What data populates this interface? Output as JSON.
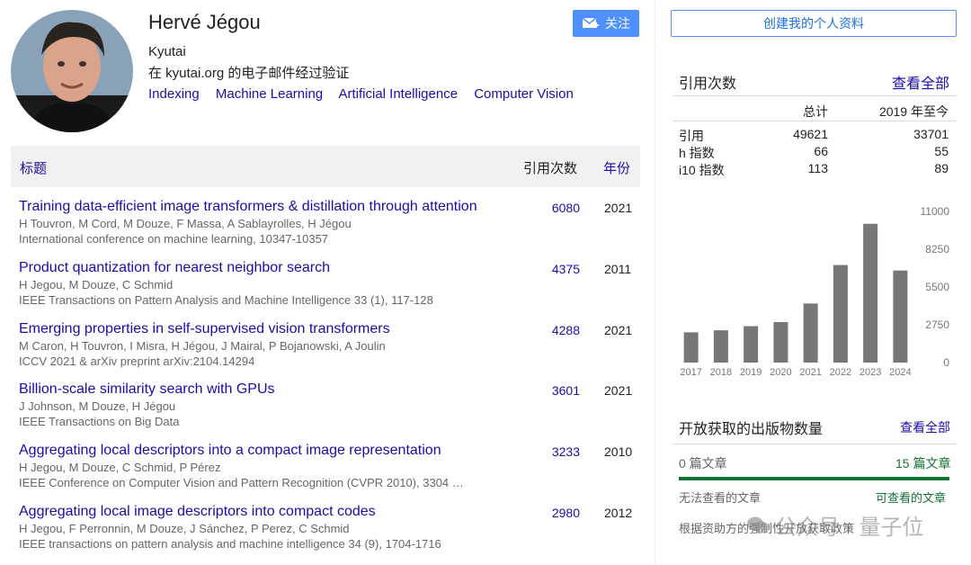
{
  "profile": {
    "name": "Hervé Jégou",
    "affiliation": "Kyutai",
    "verified_email": "在 kyutai.org 的电子邮件经过验证",
    "interests": [
      "Indexing",
      "Machine Learning",
      "Artificial Intelligence",
      "Computer Vision"
    ],
    "follow_label": "关注"
  },
  "table": {
    "headers": {
      "title": "标题",
      "cites": "引用次数",
      "year": "年份"
    },
    "rows": [
      {
        "title": "Training data-efficient image transformers & distillation through attention",
        "authors": "H Touvron, M Cord, M Douze, F Massa, A Sablayrolles, H Jégou",
        "venue": "International conference on machine learning, 10347-10357",
        "cites": "6080",
        "year": "2021"
      },
      {
        "title": "Product quantization for nearest neighbor search",
        "authors": "H Jegou, M Douze, C Schmid",
        "venue": "IEEE Transactions on Pattern Analysis and Machine Intelligence 33 (1), 117-128",
        "cites": "4375",
        "year": "2011"
      },
      {
        "title": "Emerging properties in self-supervised vision transformers",
        "authors": "M Caron, H Touvron, I Misra, H Jégou, J Mairal, P Bojanowski, A Joulin",
        "venue": "ICCV 2021 & arXiv preprint arXiv:2104.14294",
        "cites": "4288",
        "year": "2021"
      },
      {
        "title": "Billion-scale similarity search with GPUs",
        "authors": "J Johnson, M Douze, H Jégou",
        "venue": "IEEE Transactions on Big Data",
        "cites": "3601",
        "year": "2021"
      },
      {
        "title": "Aggregating local descriptors into a compact image representation",
        "authors": "H Jegou, M Douze, C Schmid, P Pérez",
        "venue": "IEEE Conference on Computer Vision and Pattern Recognition (CVPR 2010), 3304 …",
        "cites": "3233",
        "year": "2010"
      },
      {
        "title": "Aggregating local image descriptors into compact codes",
        "authors": "H Jegou, F Perronnin, M Douze, J Sánchez, P Perez, C Schmid",
        "venue": "IEEE transactions on pattern analysis and machine intelligence 34 (9), 1704-1716",
        "cites": "2980",
        "year": "2012"
      }
    ]
  },
  "sidebar": {
    "edit_profile": "创建我的个人资料",
    "cites_title": "引用次数",
    "view_all": "查看全部",
    "col_total": "总计",
    "col_since": "2019 年至今",
    "stats": [
      {
        "label": "引用",
        "total": "49621",
        "since": "33701"
      },
      {
        "label": "h 指数",
        "total": "66",
        "since": "55"
      },
      {
        "label": "i10 指数",
        "total": "113",
        "since": "89"
      }
    ],
    "open_access": {
      "title": "开放获取的出版物数量",
      "view_all": "查看全部",
      "unavailable_count": "0 篇文章",
      "available_count": "15 篇文章",
      "unavailable_label": "无法查看的文章",
      "available_label": "可查看的文章",
      "note": "根据资助方的强制性开放获取政策"
    },
    "watermark": "公众号 · 量子位"
  },
  "colors": {
    "link": "#1a0dab",
    "accent": "#4d90fe",
    "green": "#137333",
    "bar": "#777777"
  },
  "chart_data": {
    "type": "bar",
    "categories": [
      "2017",
      "2018",
      "2019",
      "2020",
      "2021",
      "2022",
      "2023",
      "2024"
    ],
    "values": [
      2200,
      2350,
      2650,
      2950,
      4300,
      7100,
      10100,
      6700
    ],
    "yticks": [
      "0",
      "2750",
      "5500",
      "8250",
      "11000"
    ],
    "ylim": [
      0,
      11000
    ]
  }
}
